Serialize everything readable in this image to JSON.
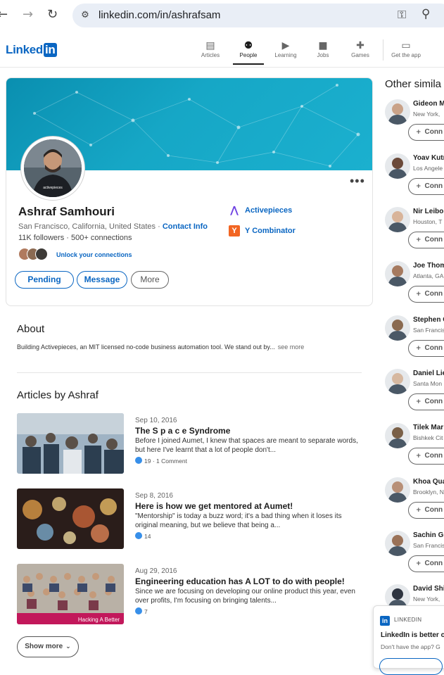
{
  "browser": {
    "url": "linkedin.com/in/ashrafsam",
    "back_icon": "←",
    "forward_icon": "→",
    "reload_icon": "↻"
  },
  "header": {
    "logo_text": "Linked",
    "logo_in": "in",
    "nav": [
      {
        "label": "Articles",
        "icon": "articles-icon",
        "glyph": "▤"
      },
      {
        "label": "People",
        "icon": "people-icon",
        "glyph": "●",
        "active": true
      },
      {
        "label": "Learning",
        "icon": "learning-icon",
        "glyph": "▶"
      },
      {
        "label": "Jobs",
        "icon": "jobs-icon",
        "glyph": "■"
      },
      {
        "label": "Games",
        "icon": "games-icon",
        "glyph": "✚"
      },
      {
        "label": "Get the app",
        "icon": "laptop-icon",
        "glyph": "▭"
      }
    ]
  },
  "profile": {
    "name": "Ashraf Samhouri",
    "location": "San Francisco, California, United States",
    "separator": " · ",
    "contact_info": "Contact Info",
    "followers": "11K followers",
    "connections": "500+ connections",
    "stats_separator": " · ",
    "unlock_text": "Unlock your connections",
    "more_dots": "•••",
    "avatar_shirt_text": "activepieces",
    "buttons": {
      "pending": "Pending",
      "message": "Message",
      "more": "More"
    },
    "companies": [
      {
        "name": "Activepieces",
        "logo": "activepieces-logo",
        "glyph": "⋀"
      },
      {
        "name": "Y Combinator",
        "logo": "ycombinator-logo",
        "glyph": "Y"
      }
    ]
  },
  "about": {
    "title": "About",
    "text": "Building Activepieces, an MIT licensed no-code business automation tool. We stand out by...",
    "see_more": "see more"
  },
  "articles": {
    "title": "Articles by Ashraf",
    "items": [
      {
        "date": "Sep 10, 2016",
        "title": "The S p a c e Syndrome",
        "excerpt": "Before I joined Aumet, I knew that spaces are meant to separate words, but here I've learnt that a lot of people don't...",
        "meta": "19 · 1 Comment"
      },
      {
        "date": "Sep 8, 2016",
        "title": "Here is how we get mentored at Aumet!",
        "excerpt": "\"Mentorship\" is today a buzz word; it's a bad thing when it loses its original meaning, but we believe that being a...",
        "meta": "14"
      },
      {
        "date": "Aug 29, 2016",
        "title": "Engineering education has A LOT to do with people!",
        "excerpt": "Since we are focusing on developing our online product this year, even over profits, I'm focusing on bringing talents...",
        "meta": "7",
        "thumb_caption": "Hacking A Better"
      }
    ],
    "show_more": "Show more",
    "chevron": "⌄"
  },
  "rail": {
    "title": "Other simila",
    "connect_label": "Conn",
    "connect_glyph": "+",
    "people": [
      {
        "name": "Gideon M",
        "location": "New York, "
      },
      {
        "name": "Yoav Kutr",
        "location": "Los Angele"
      },
      {
        "name": "Nir Leibo",
        "location": "Houston, T"
      },
      {
        "name": "Joe Thom",
        "location": "Atlanta, GA"
      },
      {
        "name": "Stephen C",
        "location": "San Francis"
      },
      {
        "name": "Daniel Lie",
        "location": "Santa Mon"
      },
      {
        "name": "Tilek Mar",
        "location": "Bishkek Cit"
      },
      {
        "name": "Khoa Qua",
        "location": "Brooklyn, N"
      },
      {
        "name": "Sachin Gu",
        "location": "San Francis"
      },
      {
        "name": "David Shi",
        "location": "New York, "
      }
    ]
  },
  "promo": {
    "brand": "LINKEDIN",
    "logo_glyph": "in",
    "headline": "LinkedIn is better c",
    "subtext": "Don't have the app? G"
  },
  "colors": {
    "accent": "#0a66c2",
    "banner": "#16a7c6",
    "like": "#378fe9"
  }
}
